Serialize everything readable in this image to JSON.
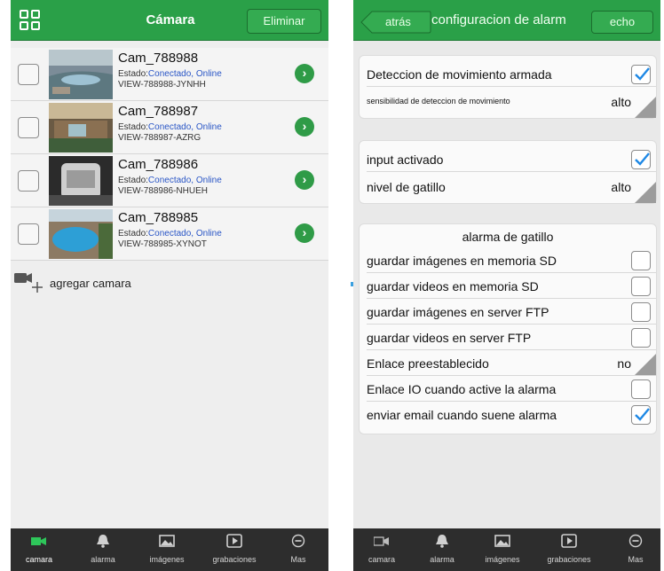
{
  "left": {
    "header": {
      "title": "Cámara",
      "delete_label": "Eliminar"
    },
    "cameras": [
      {
        "name": "Cam_788988",
        "status_label": "Estado:",
        "status_value": "Conectado, Online",
        "uid": "VIEW-788988-JYNHH"
      },
      {
        "name": "Cam_788987",
        "status_label": "Estado:",
        "status_value": "Conectado, Online",
        "uid": "VIEW-788987-AZRG"
      },
      {
        "name": "Cam_788986",
        "status_label": "Estado:",
        "status_value": "Conectado, Online",
        "uid": "VIEW-788986-NHUEH"
      },
      {
        "name": "Cam_788985",
        "status_label": "Estado:",
        "status_value": "Conectado, Online",
        "uid": "VIEW-788985-XYNOT"
      }
    ],
    "add_camera_label": "agregar camara",
    "tabs": [
      "camara",
      "alarma",
      "imágenes",
      "grabaciones",
      "Mas"
    ]
  },
  "right": {
    "header": {
      "back_label": "atrás",
      "title": "configuracion de alarm",
      "done_label": "echo"
    },
    "motion": {
      "armed_label": "Deteccion de movimiento armada",
      "sensitivity_label": "sensibilidad de deteccion de movimiento",
      "sensitivity_value": "alto"
    },
    "input": {
      "activated_label": "input activado",
      "trigger_level_label": "nivel de gatillo",
      "trigger_level_value": "alto"
    },
    "trigger_alarm": {
      "title": "alarma de gatillo",
      "items": [
        {
          "label": "guardar imágenes en memoria SD",
          "checked": false
        },
        {
          "label": "guardar videos en memoria SD",
          "checked": false
        },
        {
          "label": "guardar imágenes en server FTP",
          "checked": false
        },
        {
          "label": "guardar videos en server FTP",
          "checked": false
        },
        {
          "label": "Enlace preestablecido",
          "value": "no"
        },
        {
          "label": "Enlace IO cuando active la alarma",
          "checked": false
        },
        {
          "label": "enviar email cuando suene alarma",
          "checked": true
        }
      ]
    },
    "tabs": [
      "camara",
      "alarma",
      "imágenes",
      "grabaciones",
      "Mas"
    ]
  },
  "colors": {
    "accent": "#2aa048",
    "link_blue": "#2a56c6",
    "check_blue": "#1e88e5",
    "tabbar": "#2d2d2d"
  },
  "icons": [
    "grid-icon",
    "chevron-right-icon",
    "video-camera-add-icon",
    "video-camera-icon",
    "bell-icon",
    "image-icon",
    "play-icon",
    "more-icon",
    "back-arrow-icon",
    "checkmark-icon"
  ]
}
